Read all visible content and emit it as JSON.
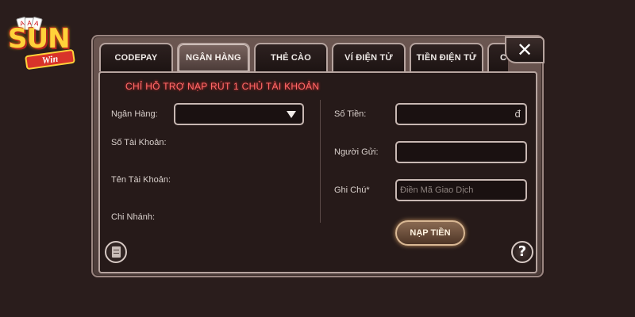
{
  "logo": {
    "text": "SUN",
    "sub": "Win"
  },
  "tabs": [
    {
      "label": "CODEPAY"
    },
    {
      "label": "NGÂN HÀNG"
    },
    {
      "label": "THẺ CÀO"
    },
    {
      "label": "VÍ ĐIỆN TỬ"
    },
    {
      "label": "TIỀN ĐIỆN TỬ"
    },
    {
      "label": "C"
    }
  ],
  "active_tab": "NGÂN HÀNG",
  "close": {
    "label": "✕"
  },
  "notice": "CHỈ HỖ TRỢ NẠP RÚT 1 CHỦ TÀI KHOẢN",
  "left_form": {
    "bank_label": "Ngân Hàng:",
    "account_number_label": "Số Tài Khoản:",
    "account_name_label": "Tên Tài Khoản:",
    "branch_label": "Chi Nhánh:"
  },
  "right_form": {
    "amount_label": "Số Tiền:",
    "amount_suffix": "đ",
    "sender_label": "Người Gửi:",
    "note_label": "Ghi Chú*",
    "note_placeholder": "Điền Mã Giao Dịch"
  },
  "submit_label": "NẠP TIỀN",
  "help_label": "?",
  "colors": {
    "background": "#2a1d1c",
    "notice": "#ff6a6a",
    "border": "#c8b8b3"
  },
  "icons": [
    "close-icon",
    "dropdown-caret-icon",
    "history-icon",
    "help-icon"
  ]
}
